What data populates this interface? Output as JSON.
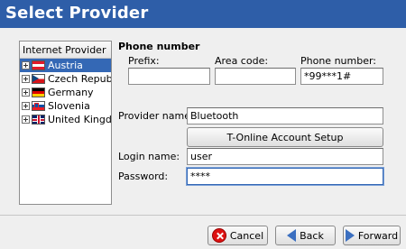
{
  "window": {
    "title": "Select Provider"
  },
  "providers": {
    "header": "Internet Provider",
    "items": [
      {
        "label": "Austria",
        "flag": "austria-flag-icon",
        "selected": true
      },
      {
        "label": "Czech Republi",
        "flag": "czech-flag-icon"
      },
      {
        "label": "Germany",
        "flag": "germany-flag-icon"
      },
      {
        "label": "Slovenia",
        "flag": "slovenia-flag-icon"
      },
      {
        "label": "United Kingdor",
        "flag": "uk-flag-icon"
      }
    ]
  },
  "phone": {
    "section_title": "Phone number",
    "prefix_label": "Prefix:",
    "prefix_value": "",
    "area_label": "Area code:",
    "area_value": "",
    "number_label": "Phone number:",
    "number_value": "*99***1#"
  },
  "provider_name": {
    "label": "Provider name:",
    "value": "Bluetooth"
  },
  "setup_button": "T-Online Account Setup",
  "login": {
    "label": "Login name:",
    "value": "user"
  },
  "password": {
    "label": "Password:",
    "value": "****"
  },
  "buttons": {
    "cancel": "Cancel",
    "back": "Back",
    "forward": "Forward"
  },
  "colors": {
    "header": "#2e5ea8",
    "selection": "#3468b5"
  }
}
